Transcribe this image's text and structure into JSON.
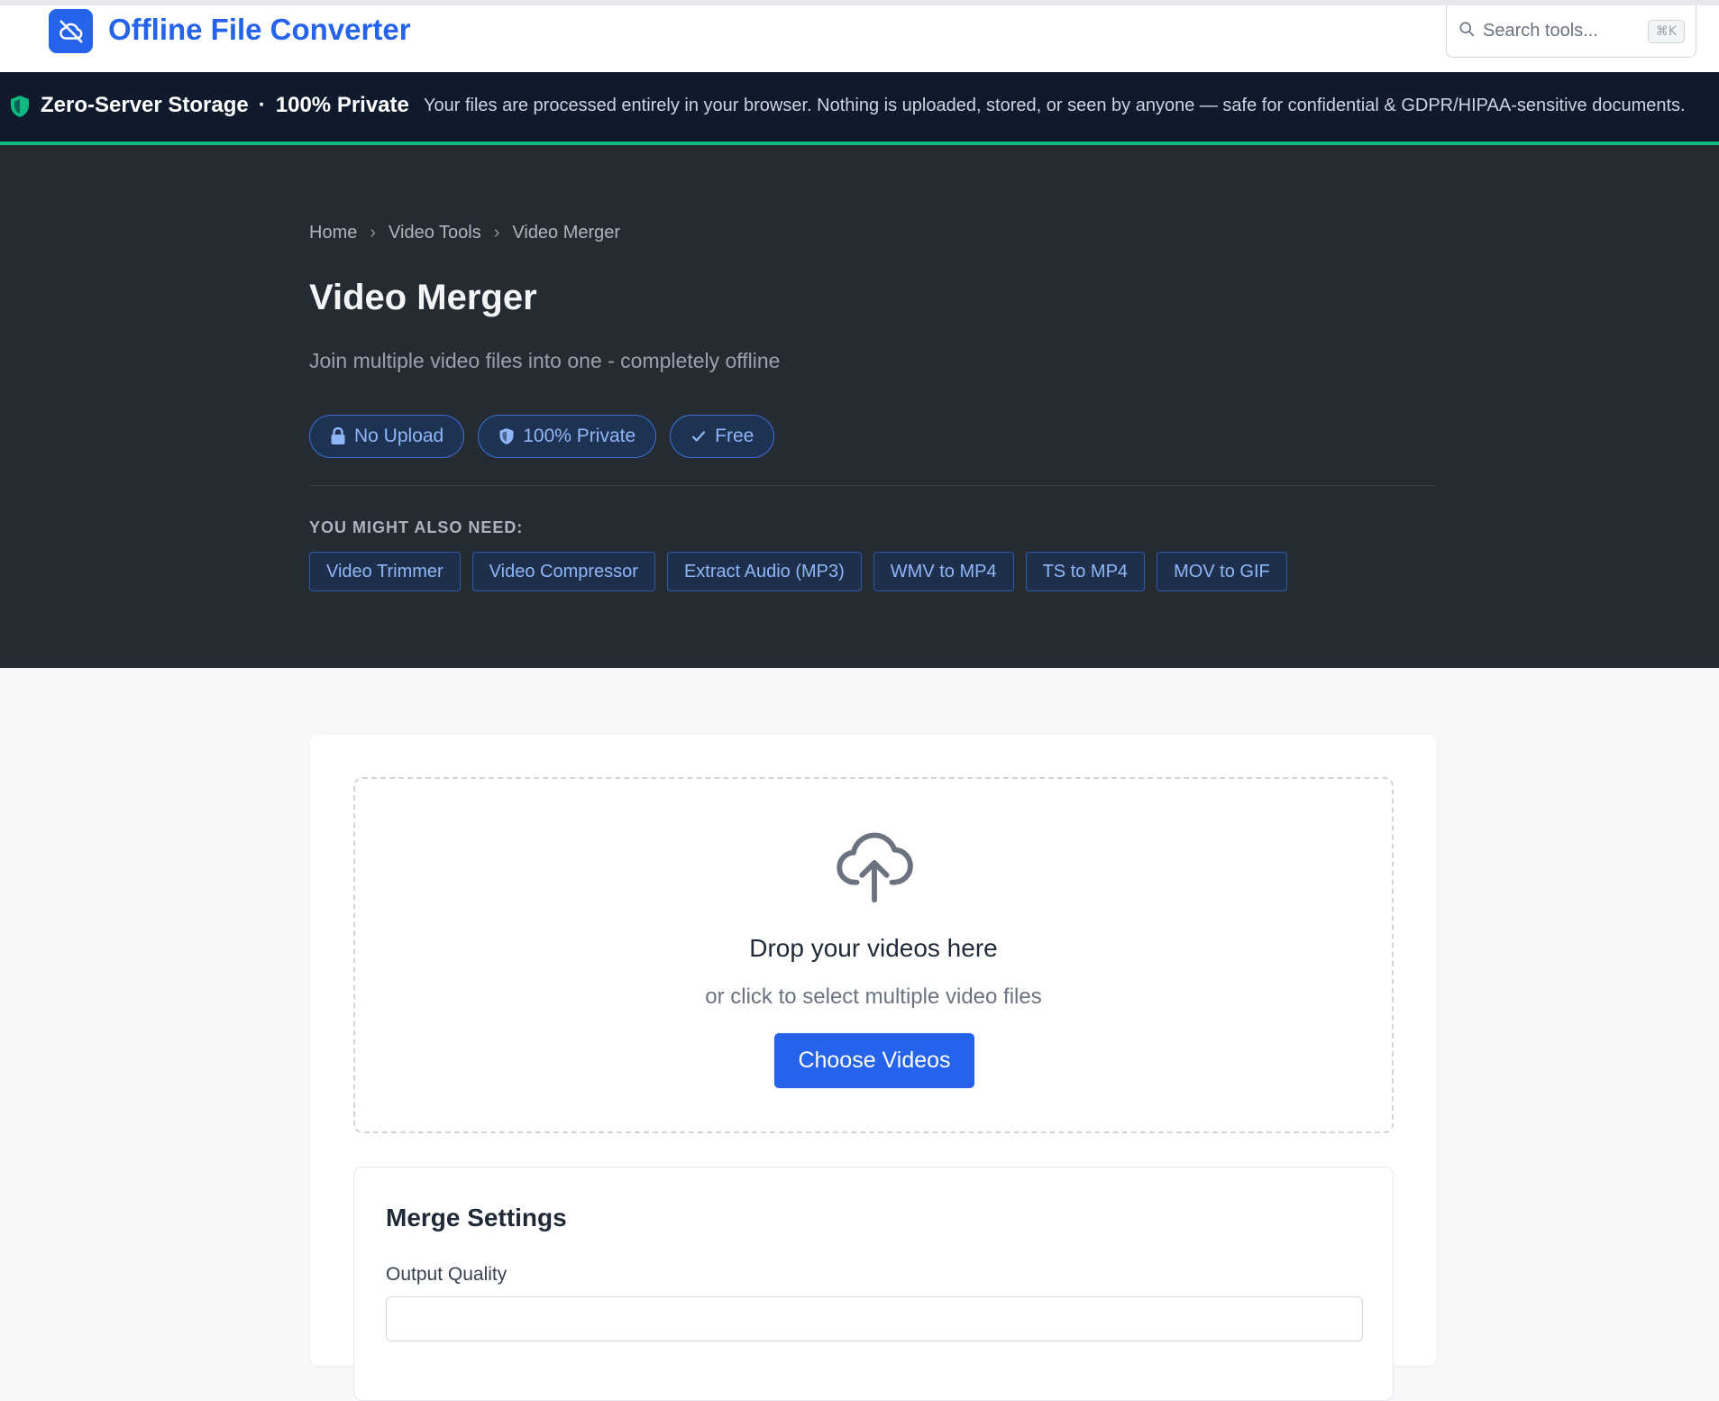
{
  "header": {
    "app_title": "Offline File Converter",
    "logo_icon": "cloud-off-icon",
    "search": {
      "placeholder": "Search tools...",
      "shortcut": "⌘K"
    }
  },
  "banner": {
    "label_storage": "Zero-Server Storage",
    "separator": "·",
    "label_private": "100% Private",
    "message": "Your files are processed entirely in your browser. Nothing is uploaded, stored, or seen by anyone — safe for confidential & GDPR/HIPAA-sensitive documents.",
    "accent_color": "#10b981"
  },
  "breadcrumb": [
    "Home",
    "Video Tools",
    "Video Merger"
  ],
  "page": {
    "title": "Video Merger",
    "subtitle": "Join multiple video files into one - completely offline"
  },
  "badges": [
    {
      "icon": "lock-icon",
      "label": "No Upload"
    },
    {
      "icon": "shield-icon",
      "label": "100% Private"
    },
    {
      "icon": "check-icon",
      "label": "Free"
    }
  ],
  "related": {
    "title": "YOU MIGHT ALSO NEED:",
    "tools": [
      "Video Trimmer",
      "Video Compressor",
      "Extract Audio (MP3)",
      "WMV to MP4",
      "TS to MP4",
      "MOV to GIF"
    ]
  },
  "dropzone": {
    "icon": "cloud-upload-icon",
    "title": "Drop your videos here",
    "subtitle": "or click to select multiple video files",
    "button": "Choose Videos"
  },
  "settings": {
    "title": "Merge Settings",
    "output_quality_label": "Output Quality"
  },
  "colors": {
    "brand": "#2563eb",
    "hero_bg": "#252b33",
    "banner_bg": "#0f1b2d"
  }
}
